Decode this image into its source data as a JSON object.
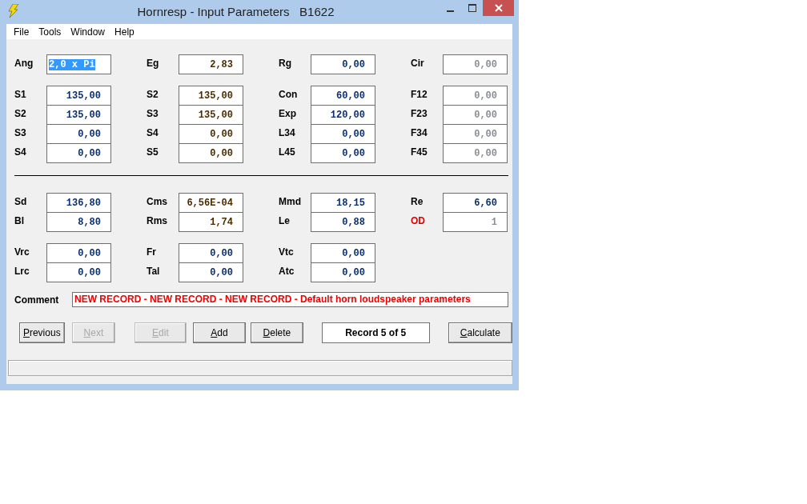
{
  "window": {
    "title": "Hornresp - Input Parameters   B1622"
  },
  "menu": [
    "File",
    "Tools",
    "Window",
    "Help"
  ],
  "sections": [
    {
      "groups": [
        [
          [
            {
              "label": "Ang",
              "value": "2,0 x Pi",
              "kind": "input",
              "selected": true,
              "label_alert": false
            },
            {
              "label": "Eg",
              "value": "2,83",
              "kind": "alt",
              "selected": false,
              "label_alert": false
            },
            {
              "label": "Rg",
              "value": "0,00",
              "kind": "input",
              "selected": false,
              "label_alert": false
            },
            {
              "label": "Cir",
              "value": "0,00",
              "kind": "readonly",
              "selected": false,
              "label_alert": false
            }
          ]
        ],
        [
          [
            {
              "label": "S1",
              "value": "135,00",
              "kind": "input",
              "selected": false,
              "label_alert": false
            },
            {
              "label": "S2",
              "value": "135,00",
              "kind": "alt",
              "selected": false,
              "label_alert": false
            },
            {
              "label": "Con",
              "value": "60,00",
              "kind": "input",
              "selected": false,
              "label_alert": false
            },
            {
              "label": "F12",
              "value": "0,00",
              "kind": "readonly",
              "selected": false,
              "label_alert": false
            }
          ],
          [
            {
              "label": "S2",
              "value": "135,00",
              "kind": "input",
              "selected": false,
              "label_alert": false
            },
            {
              "label": "S3",
              "value": "135,00",
              "kind": "alt",
              "selected": false,
              "label_alert": false
            },
            {
              "label": "Exp",
              "value": "120,00",
              "kind": "input",
              "selected": false,
              "label_alert": false
            },
            {
              "label": "F23",
              "value": "0,00",
              "kind": "readonly",
              "selected": false,
              "label_alert": false
            }
          ],
          [
            {
              "label": "S3",
              "value": "0,00",
              "kind": "input",
              "selected": false,
              "label_alert": false
            },
            {
              "label": "S4",
              "value": "0,00",
              "kind": "alt",
              "selected": false,
              "label_alert": false
            },
            {
              "label": "L34",
              "value": "0,00",
              "kind": "input",
              "selected": false,
              "label_alert": false
            },
            {
              "label": "F34",
              "value": "0,00",
              "kind": "readonly",
              "selected": false,
              "label_alert": false
            }
          ],
          [
            {
              "label": "S4",
              "value": "0,00",
              "kind": "input",
              "selected": false,
              "label_alert": false
            },
            {
              "label": "S5",
              "value": "0,00",
              "kind": "alt",
              "selected": false,
              "label_alert": false
            },
            {
              "label": "L45",
              "value": "0,00",
              "kind": "input",
              "selected": false,
              "label_alert": false
            },
            {
              "label": "F45",
              "value": "0,00",
              "kind": "readonly",
              "selected": false,
              "label_alert": false
            }
          ]
        ]
      ]
    },
    {
      "groups": [
        [
          [
            {
              "label": "Sd",
              "value": "136,80",
              "kind": "input",
              "selected": false,
              "label_alert": false
            },
            {
              "label": "Cms",
              "value": "6,56E-04",
              "kind": "alt",
              "selected": false,
              "label_alert": false
            },
            {
              "label": "Mmd",
              "value": "18,15",
              "kind": "input",
              "selected": false,
              "label_alert": false
            },
            {
              "label": "Re",
              "value": "6,60",
              "kind": "input",
              "selected": false,
              "label_alert": false
            }
          ],
          [
            {
              "label": "Bl",
              "value": "8,80",
              "kind": "input",
              "selected": false,
              "label_alert": false
            },
            {
              "label": "Rms",
              "value": "1,74",
              "kind": "alt",
              "selected": false,
              "label_alert": false
            },
            {
              "label": "Le",
              "value": "0,88",
              "kind": "input",
              "selected": false,
              "label_alert": false
            },
            {
              "label": "OD",
              "value": "1",
              "kind": "readonly",
              "selected": false,
              "label_alert": true
            }
          ]
        ],
        [
          [
            {
              "label": "Vrc",
              "value": "0,00",
              "kind": "input",
              "selected": false,
              "label_alert": false
            },
            {
              "label": "Fr",
              "value": "0,00",
              "kind": "input",
              "selected": false,
              "label_alert": false
            },
            {
              "label": "Vtc",
              "value": "0,00",
              "kind": "input",
              "selected": false,
              "label_alert": false
            }
          ],
          [
            {
              "label": "Lrc",
              "value": "0,00",
              "kind": "input",
              "selected": false,
              "label_alert": false
            },
            {
              "label": "Tal",
              "value": "0,00",
              "kind": "input",
              "selected": false,
              "label_alert": false
            },
            {
              "label": "Atc",
              "value": "0,00",
              "kind": "input",
              "selected": false,
              "label_alert": false
            }
          ]
        ]
      ]
    }
  ],
  "comment": {
    "label": "Comment",
    "value": "NEW RECORD - NEW RECORD - NEW RECORD - Default horn loudspeaker parameters"
  },
  "buttons": [
    {
      "accel": "P",
      "rest": "revious",
      "disabled": false
    },
    {
      "accel": "N",
      "rest": "ext",
      "disabled": true
    },
    {
      "accel": "E",
      "rest": "dit",
      "disabled": true
    },
    {
      "accel": "A",
      "rest": "dd",
      "disabled": false
    },
    {
      "accel": "D",
      "rest": "elete",
      "disabled": false
    }
  ],
  "record": "Record 5 of 5",
  "calculate": {
    "accel": "C",
    "rest": "alculate",
    "disabled": false
  }
}
